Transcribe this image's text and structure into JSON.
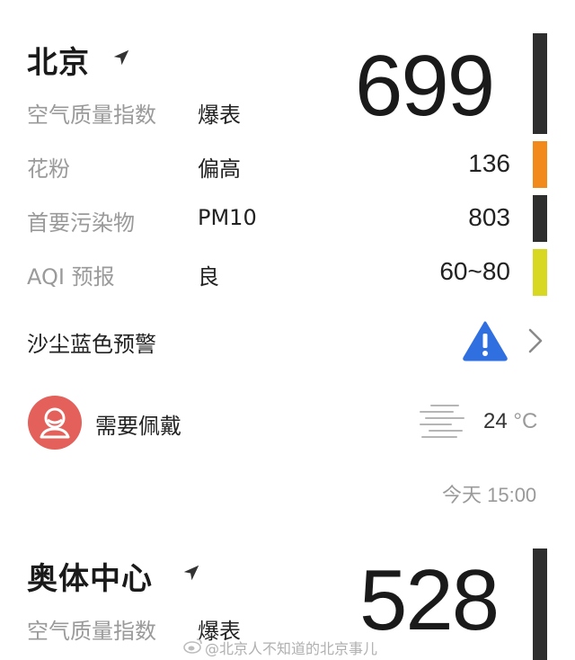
{
  "colors": {
    "bar_dark": "#2e2e2e",
    "bar_orange": "#f28a1b",
    "bar_yellow": "#d8d823",
    "alert_blue": "#2f6fe0",
    "avatar_red": "#e4605b"
  },
  "card1": {
    "city": "北京",
    "aqi": "699",
    "rows": [
      {
        "label": "空气质量指数",
        "value": "爆表"
      },
      {
        "label": "花粉",
        "value": "偏高",
        "num": "136"
      },
      {
        "label": "首要污染物",
        "value": "PM10",
        "num": "803"
      },
      {
        "label": "AQI 预报",
        "value": "良",
        "num": "60~80"
      }
    ],
    "alert": "沙尘蓝色预警",
    "alert_icon": "warning-triangle-icon",
    "advice": "需要佩戴",
    "advice_icon": "mask-person-icon",
    "weather_icon": "haze-icon",
    "temperature": "24",
    "temperature_unit": "°C",
    "updated": "今天 15:00"
  },
  "card2": {
    "city": "奥体中心",
    "aqi": "528",
    "rows": [
      {
        "label": "空气质量指数",
        "value": "爆表"
      }
    ]
  },
  "watermark": "@北京人不知道的北京事儿"
}
